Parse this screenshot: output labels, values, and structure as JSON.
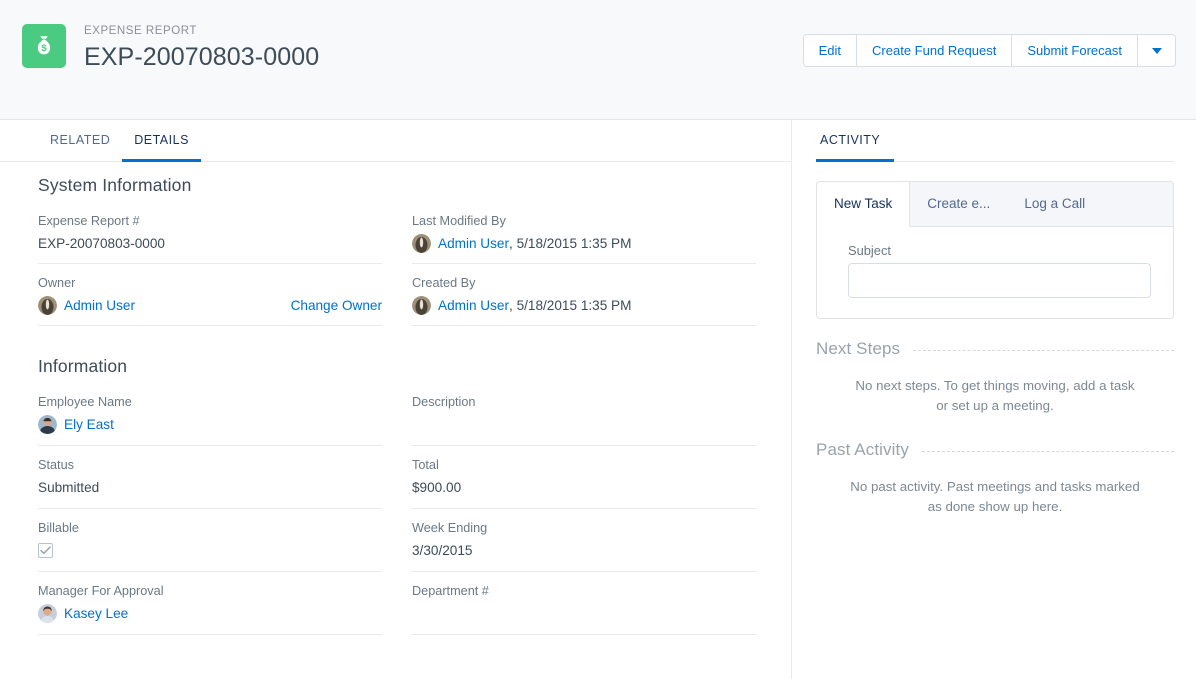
{
  "header": {
    "record_type": "EXPENSE REPORT",
    "record_name": "EXP-20070803-0000",
    "icon": "money-bag-icon",
    "icon_color": "#4bca81",
    "actions": [
      {
        "label": "Edit",
        "name": "edit-button"
      },
      {
        "label": "Create Fund Request",
        "name": "create-fund-request-button"
      },
      {
        "label": "Submit Forecast",
        "name": "submit-forecast-button"
      }
    ],
    "more_actions_icon": "chevron-down-icon"
  },
  "tabs": [
    {
      "label": "RELATED",
      "active": false
    },
    {
      "label": "DETAILS",
      "active": true
    }
  ],
  "system_information": {
    "title": "System Information",
    "left": [
      {
        "label": "Expense Report #",
        "value": "EXP-20070803-0000",
        "type": "text"
      },
      {
        "label": "Owner",
        "value": "Admin User",
        "type": "user",
        "action_label": "Change Owner",
        "avatar": "admin-user-avatar"
      }
    ],
    "right": [
      {
        "label": "Last Modified By",
        "value": "Admin User",
        "suffix": ", 5/18/2015 1:35 PM",
        "type": "user",
        "avatar": "admin-user-avatar"
      },
      {
        "label": "Created By",
        "value": "Admin User",
        "suffix": ", 5/18/2015 1:35 PM",
        "type": "user",
        "avatar": "admin-user-avatar"
      }
    ]
  },
  "information": {
    "title": "Information",
    "left": [
      {
        "label": "Employee Name",
        "value": "Ely East",
        "type": "user",
        "avatar": "ely-east-avatar"
      },
      {
        "label": "Status",
        "value": "Submitted",
        "type": "text"
      },
      {
        "label": "Billable",
        "value": "",
        "type": "checkbox",
        "checked": true
      },
      {
        "label": "Manager For Approval",
        "value": "Kasey Lee",
        "type": "user",
        "avatar": "kasey-lee-avatar"
      }
    ],
    "right": [
      {
        "label": "Description",
        "value": "",
        "type": "text"
      },
      {
        "label": "Total",
        "value": "$900.00",
        "type": "text"
      },
      {
        "label": "Week Ending",
        "value": "3/30/2015",
        "type": "text"
      },
      {
        "label": "Department #",
        "value": "",
        "type": "text"
      }
    ]
  },
  "activity": {
    "tab_label": "ACTIVITY",
    "composer_tabs": [
      {
        "label": "New Task",
        "active": true
      },
      {
        "label": "Create e...",
        "active": false
      },
      {
        "label": "Log a Call",
        "active": false
      }
    ],
    "subject_label": "Subject",
    "subject_value": "",
    "subject_placeholder": "",
    "next_steps": {
      "title": "Next Steps",
      "empty_message": "No next steps. To get things moving, add a task or set up a meeting."
    },
    "past_activity": {
      "title": "Past Activity",
      "empty_message": "No past activity. Past meetings and tasks marked as done show up here."
    }
  },
  "colors": {
    "link": "#0070d2",
    "accent": "#0070d2",
    "icon_green": "#4bca81",
    "header_bg": "#f7f9fb"
  }
}
